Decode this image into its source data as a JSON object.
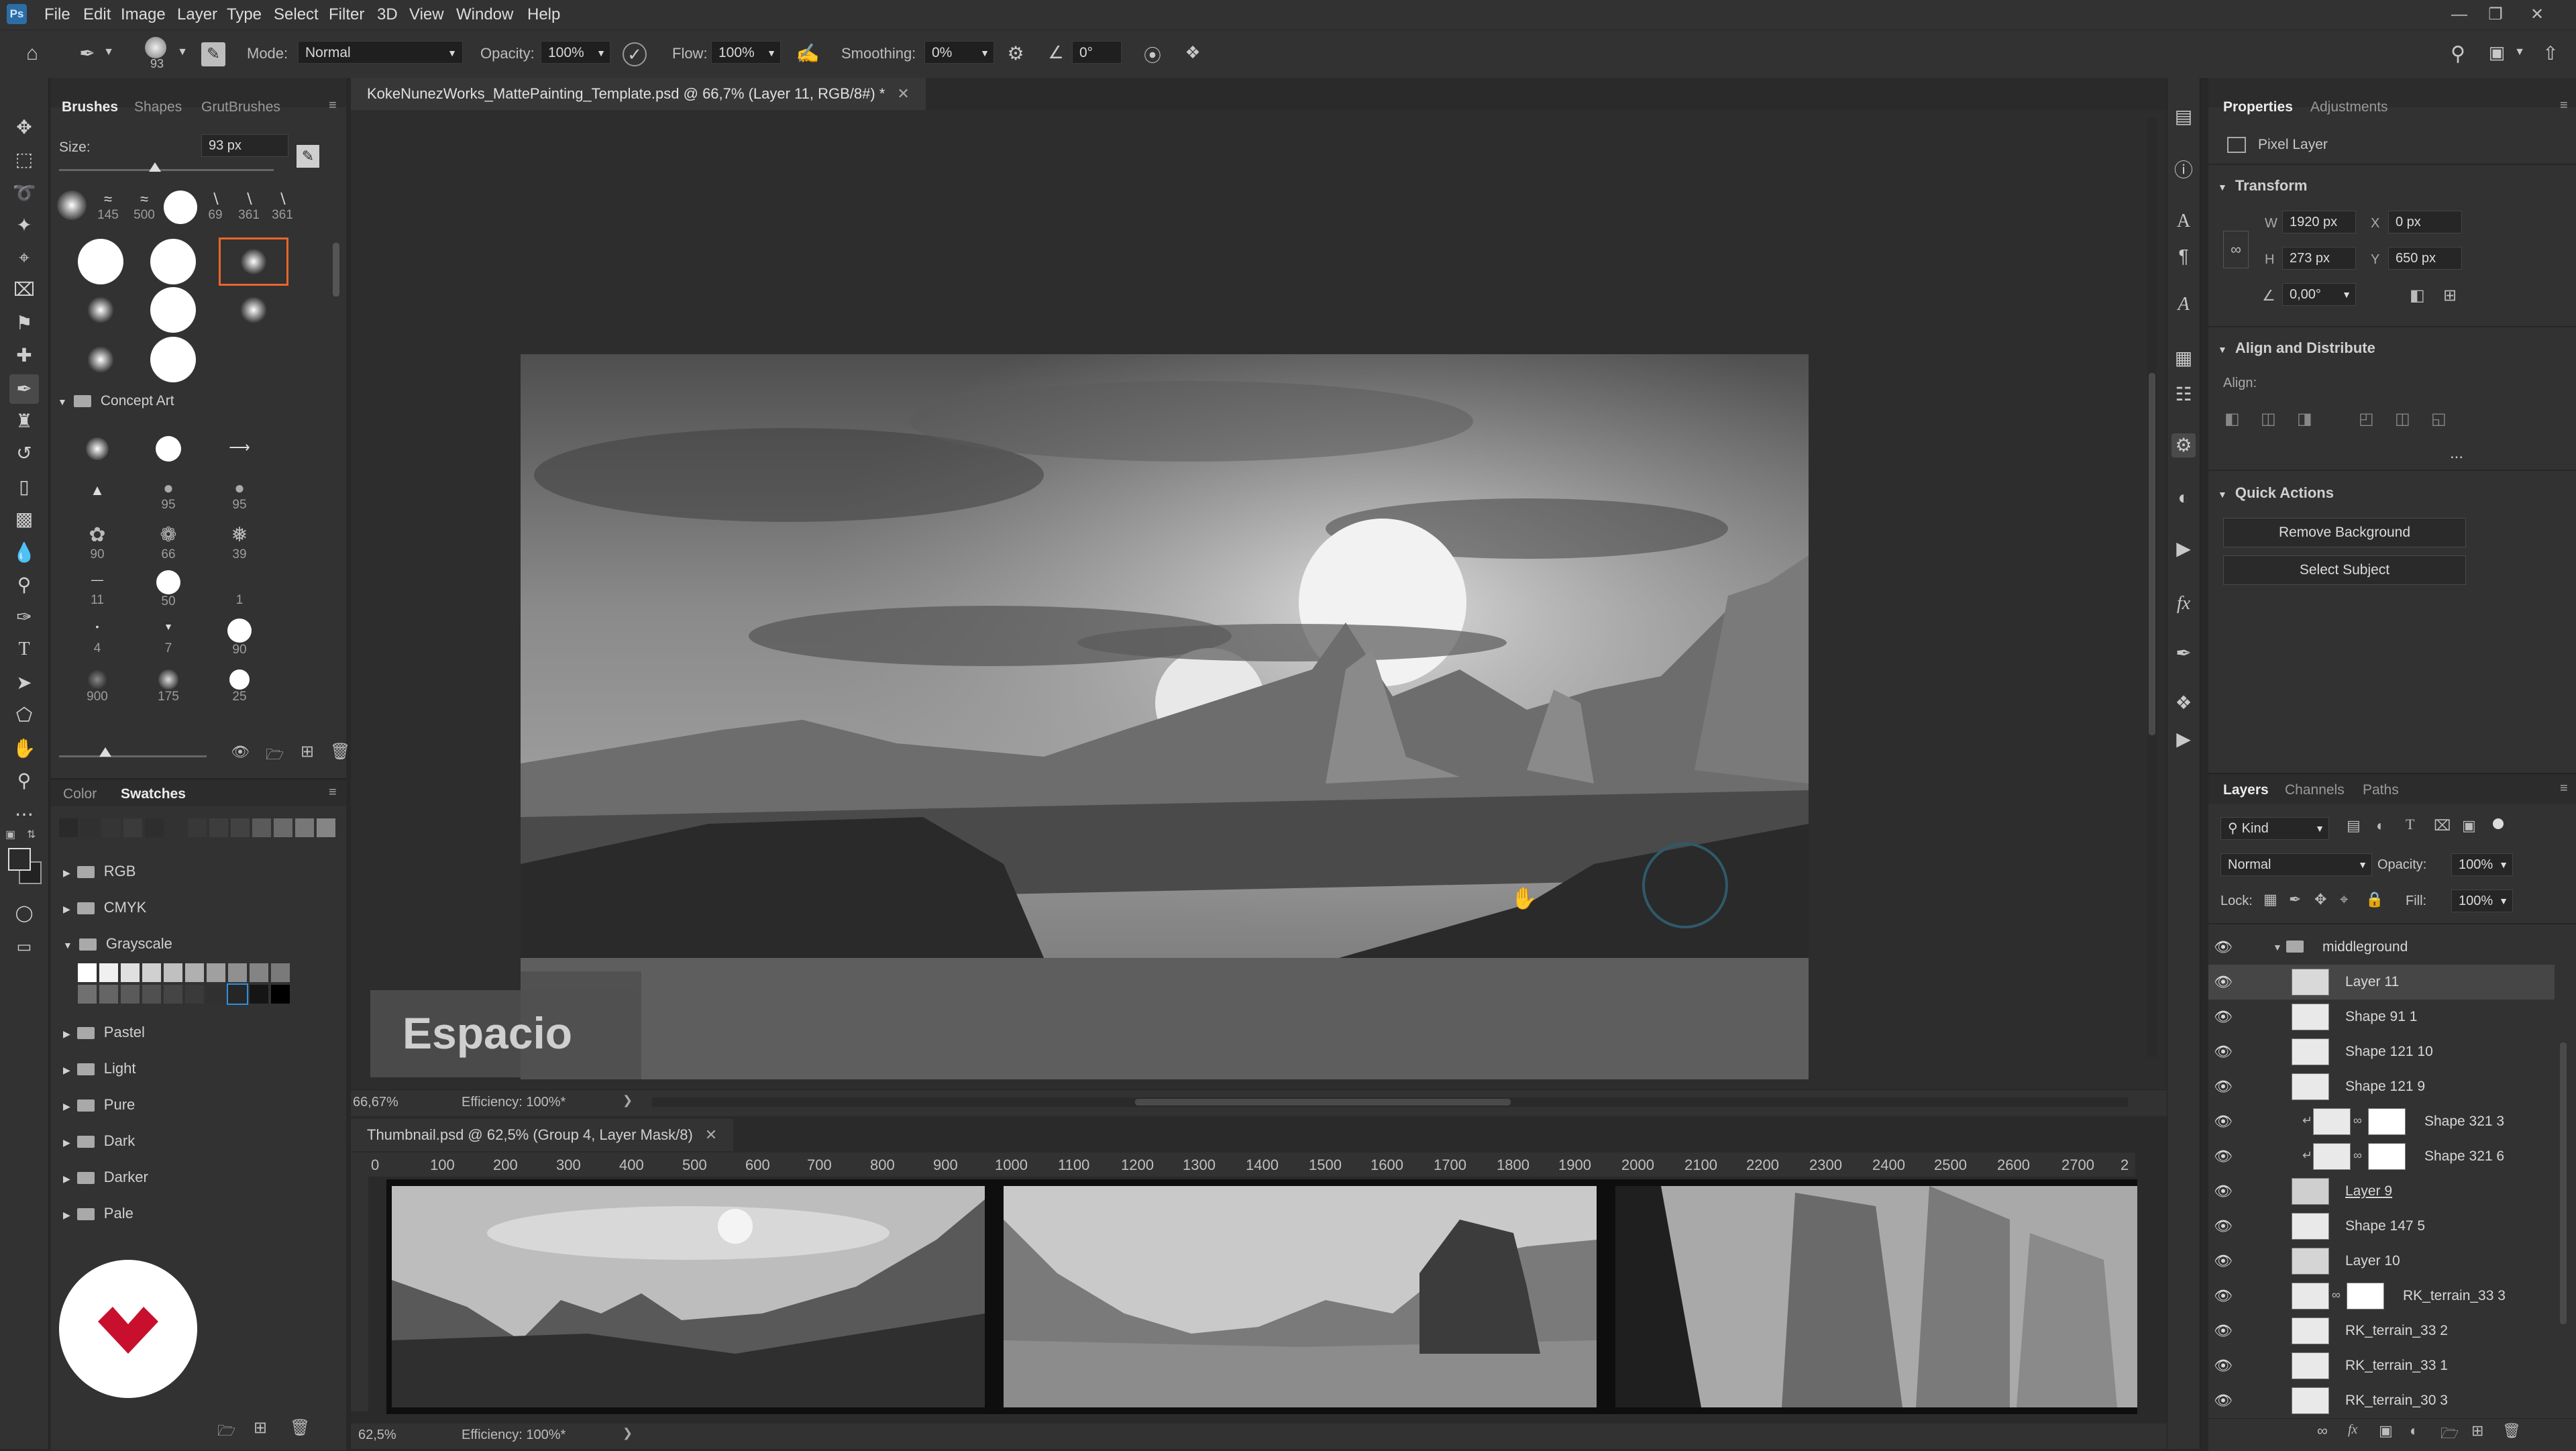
{
  "app": {
    "logo": "Ps"
  },
  "menu": [
    "File",
    "Edit",
    "Image",
    "Layer",
    "Type",
    "Select",
    "Filter",
    "3D",
    "View",
    "Window",
    "Help"
  ],
  "options": {
    "brush_size": "93",
    "mode_label": "Mode:",
    "mode_value": "Normal",
    "opacity_label": "Opacity:",
    "opacity_value": "100%",
    "flow_label": "Flow:",
    "flow_value": "100%",
    "smoothing_label": "Smoothing:",
    "smoothing_value": "0%",
    "angle_value": "0°"
  },
  "brushes_panel": {
    "tabs": [
      "Brushes",
      "Shapes",
      "GrutBrushes"
    ],
    "size_label": "Size:",
    "size_value": "93 px",
    "recent": [
      "145",
      "500",
      "69",
      "361",
      "361"
    ],
    "group_name": "Concept Art",
    "concept_labels": [
      "95",
      "95",
      "90",
      "66",
      "39",
      "11",
      "50",
      "1",
      "4",
      "7",
      "90",
      "900",
      "175",
      "25"
    ]
  },
  "swatches_panel": {
    "tabs": [
      "Color",
      "Swatches"
    ],
    "groups": [
      "RGB",
      "CMYK",
      "Grayscale",
      "Pastel",
      "Light",
      "Pure",
      "Dark",
      "Darker",
      "Pale"
    ]
  },
  "document": {
    "tab_title": "KokeNunezWorks_MattePainting_Template.psd @ 66,7% (Layer 11, RGB/8#) *",
    "zoom": "66,67%",
    "efficiency": "Efficiency: 100%*",
    "overlay_text": "Espacio"
  },
  "document2": {
    "tab_title": "Thumbnail.psd @ 62,5% (Group 4, Layer Mask/8)",
    "zoom": "62,5%",
    "efficiency": "Efficiency: 100%*",
    "ruler": [
      "0",
      "100",
      "200",
      "300",
      "400",
      "500",
      "600",
      "700",
      "800",
      "900",
      "1000",
      "1100",
      "1200",
      "1300",
      "1400",
      "1500",
      "1600",
      "1700",
      "1800",
      "1900",
      "2000",
      "2100",
      "2200",
      "2300",
      "2400",
      "2500",
      "2600",
      "2700",
      "2"
    ]
  },
  "properties": {
    "tabs": [
      "Properties",
      "Adjustments"
    ],
    "kind": "Pixel Layer",
    "transform_title": "Transform",
    "w_label": "W",
    "w_value": "1920 px",
    "x_label": "X",
    "x_value": "0 px",
    "h_label": "H",
    "h_value": "273 px",
    "y_label": "Y",
    "y_value": "650 px",
    "angle_value": "0,00°",
    "align_title": "Align and Distribute",
    "align_label": "Align:",
    "more": "...",
    "quick_title": "Quick Actions",
    "remove_bg": "Remove Background",
    "select_subject": "Select Subject"
  },
  "layers_panel": {
    "tabs": [
      "Layers",
      "Channels",
      "Paths"
    ],
    "filter": "Kind",
    "blend": "Normal",
    "opacity_label": "Opacity:",
    "opacity_value": "100%",
    "lock_label": "Lock:",
    "fill_label": "Fill:",
    "fill_value": "100%",
    "layers": [
      {
        "name": "middleground"
      },
      {
        "name": "Layer 11"
      },
      {
        "name": "Shape 91 1"
      },
      {
        "name": "Shape 121 10"
      },
      {
        "name": "Shape 121 9"
      },
      {
        "name": "Shape 321 3"
      },
      {
        "name": "Shape 321 6"
      },
      {
        "name": "Layer 9"
      },
      {
        "name": "Shape 147 5"
      },
      {
        "name": "Layer 10"
      },
      {
        "name": "RK_terrain_33 3"
      },
      {
        "name": "RK_terrain_33 2"
      },
      {
        "name": "RK_terrain_33 1"
      },
      {
        "name": "RK_terrain_30 3"
      }
    ]
  },
  "colors": {
    "accent": "#e8662a",
    "selected_row": "#464646",
    "brand_logo": "#c8102e"
  }
}
